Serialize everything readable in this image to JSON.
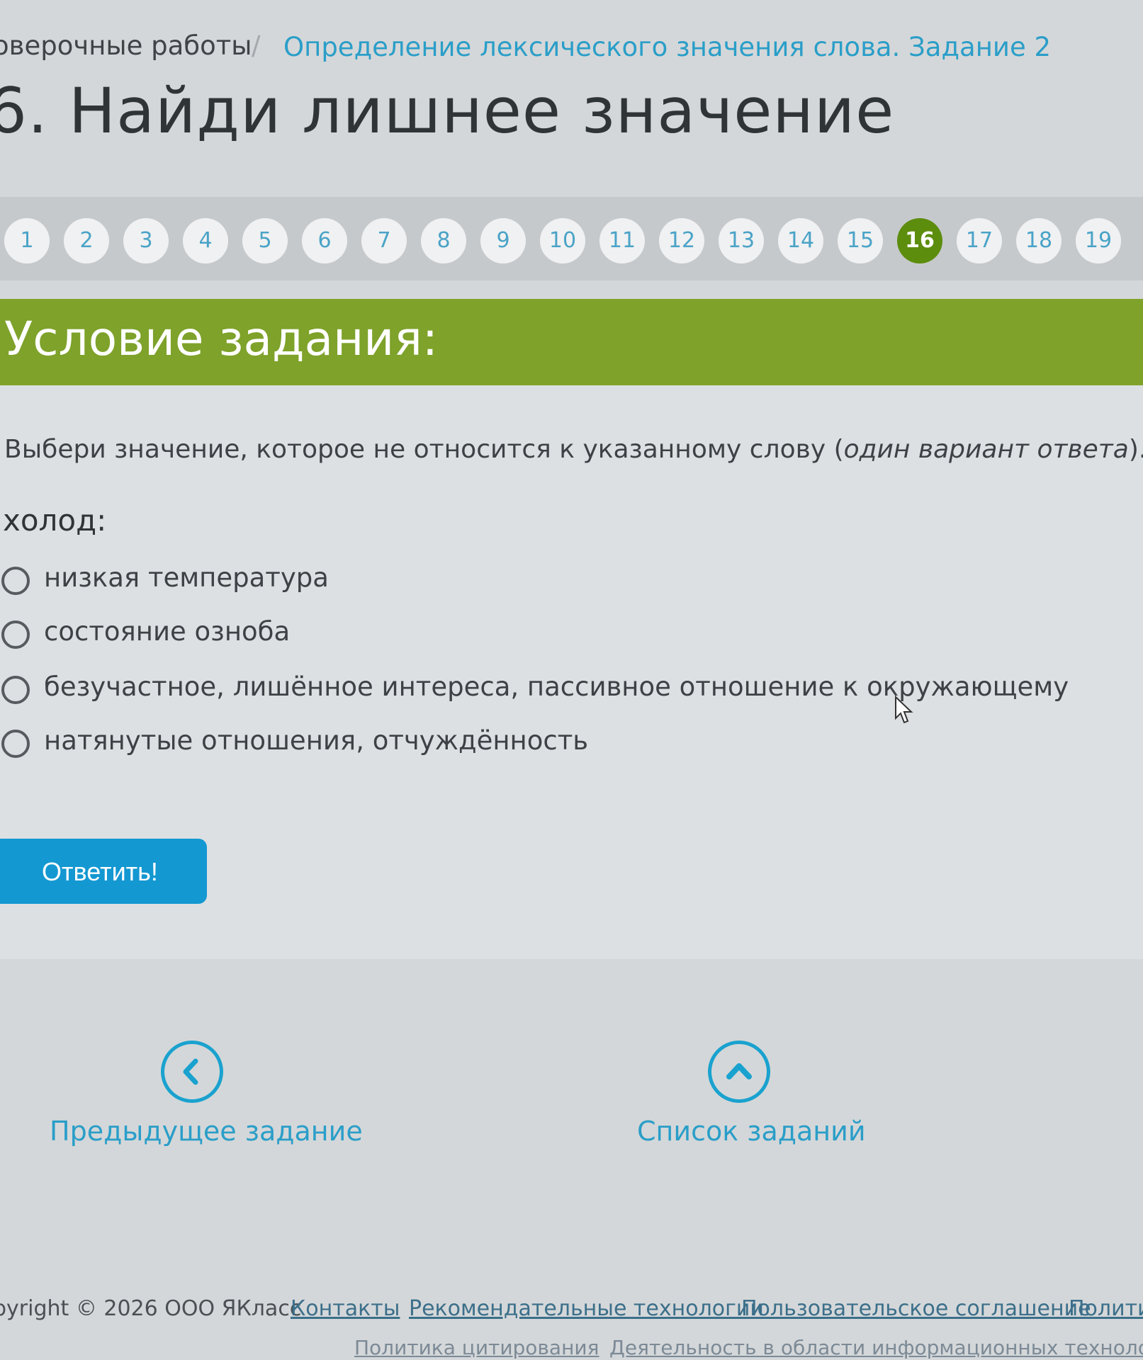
{
  "breadcrumb": {
    "parent": "оверочные работы",
    "separator": "/",
    "current": "Определение лексического значения слова. Задание 2"
  },
  "page_title": "6. Найди лишнее значение",
  "pager": {
    "items": [
      "1",
      "2",
      "3",
      "4",
      "5",
      "6",
      "7",
      "8",
      "9",
      "10",
      "11",
      "12",
      "13",
      "14",
      "15",
      "16",
      "17",
      "18",
      "19"
    ],
    "active": "16"
  },
  "task": {
    "section_title": "Условие задания:",
    "instruction_text": "Выбери значение, которое не относится к указанному слову (",
    "instruction_hint": "один вариант ответа",
    "instruction_end": ").",
    "word": "холод:",
    "options": [
      "низкая температура",
      "состояние озноба",
      "безучастное, лишённое интереса, пассивное отношение к окружающему",
      "натянутые отношения, отчуждённость"
    ],
    "answer_button": "Ответить!"
  },
  "nav": {
    "prev_label": "Предыдущее задание",
    "list_label": "Список заданий",
    "prev_icon": "chevron-left-icon",
    "list_icon": "chevron-up-icon"
  },
  "footer": {
    "copyright": "pyright © 2026 ООО ЯКласс",
    "links": [
      "Контакты",
      "Рекомендательные технологии",
      "Пользовательское соглашение",
      "Полити"
    ],
    "second_row": [
      "Политика цитирования",
      "Деятельность в области информационных технологий"
    ]
  },
  "colors": {
    "accent_green": "#7ea22a",
    "active_page": "#5c8d0d",
    "link_blue": "#2a9ec8",
    "button_blue": "#1398d2"
  }
}
